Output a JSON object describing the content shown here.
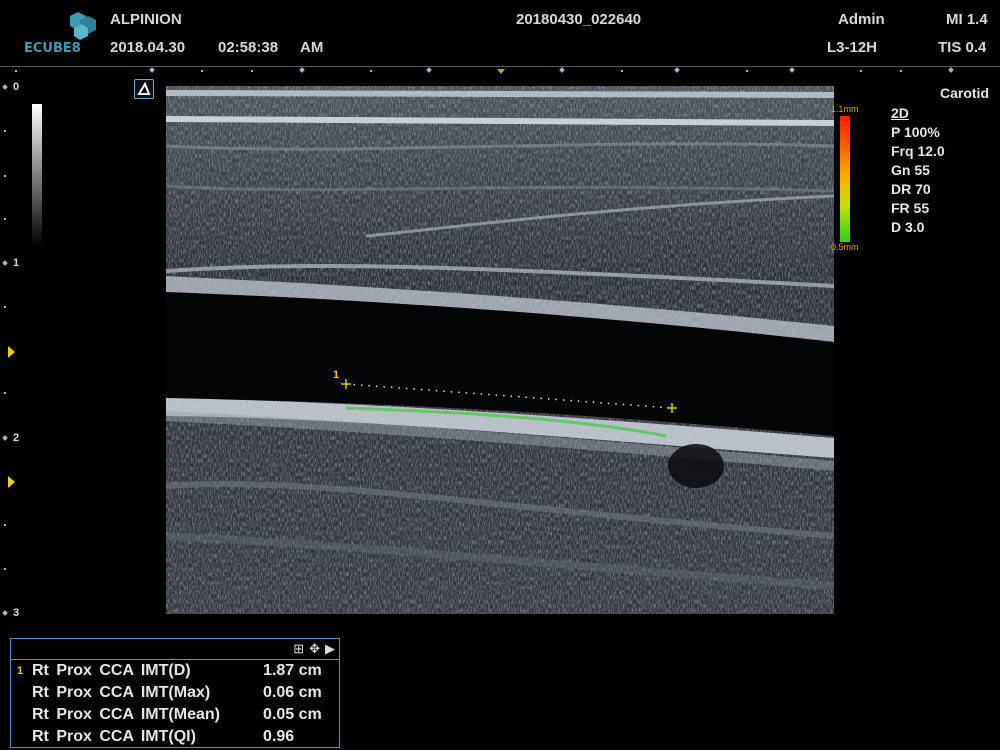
{
  "header": {
    "brand": "ECUBE8",
    "vendor": "ALPINION",
    "date": "2018.04.30",
    "time": "02:58:38",
    "ampm": "AM",
    "study_id": "20180430_022640",
    "user": "Admin",
    "probe": "L3-12H",
    "mi": "MI 1.4",
    "tis": "TIS 0.4"
  },
  "depth_scale": {
    "labels": [
      "0",
      "1",
      "2",
      "3"
    ]
  },
  "colorbar": {
    "top_label": "1.1mm",
    "bottom_label": "0.5mm"
  },
  "imaging_params": {
    "preset": "Carotid",
    "mode": "2D",
    "items": [
      "P 100%",
      "Frq 12.0",
      "Gn 55",
      "DR 70",
      "FR 55",
      "D 3.0"
    ]
  },
  "measurement": {
    "caliper_label": "1"
  },
  "results": {
    "rows": [
      {
        "index": "1",
        "name": "Rt Prox CCA IMT(D)",
        "value": "1.87 cm"
      },
      {
        "index": "",
        "name": "Rt Prox CCA IMT(Max)",
        "value": "0.06 cm"
      },
      {
        "index": "",
        "name": "Rt Prox CCA IMT(Mean)",
        "value": "0.05 cm"
      },
      {
        "index": "",
        "name": "Rt Prox CCA IMT(QI)",
        "value": "0.96"
      }
    ]
  },
  "colors": {
    "caliper": "#e8d000",
    "imt_trace": "#3ccc3c",
    "panel_border": "#6a8fb4",
    "logo": "#3d9bb4"
  }
}
